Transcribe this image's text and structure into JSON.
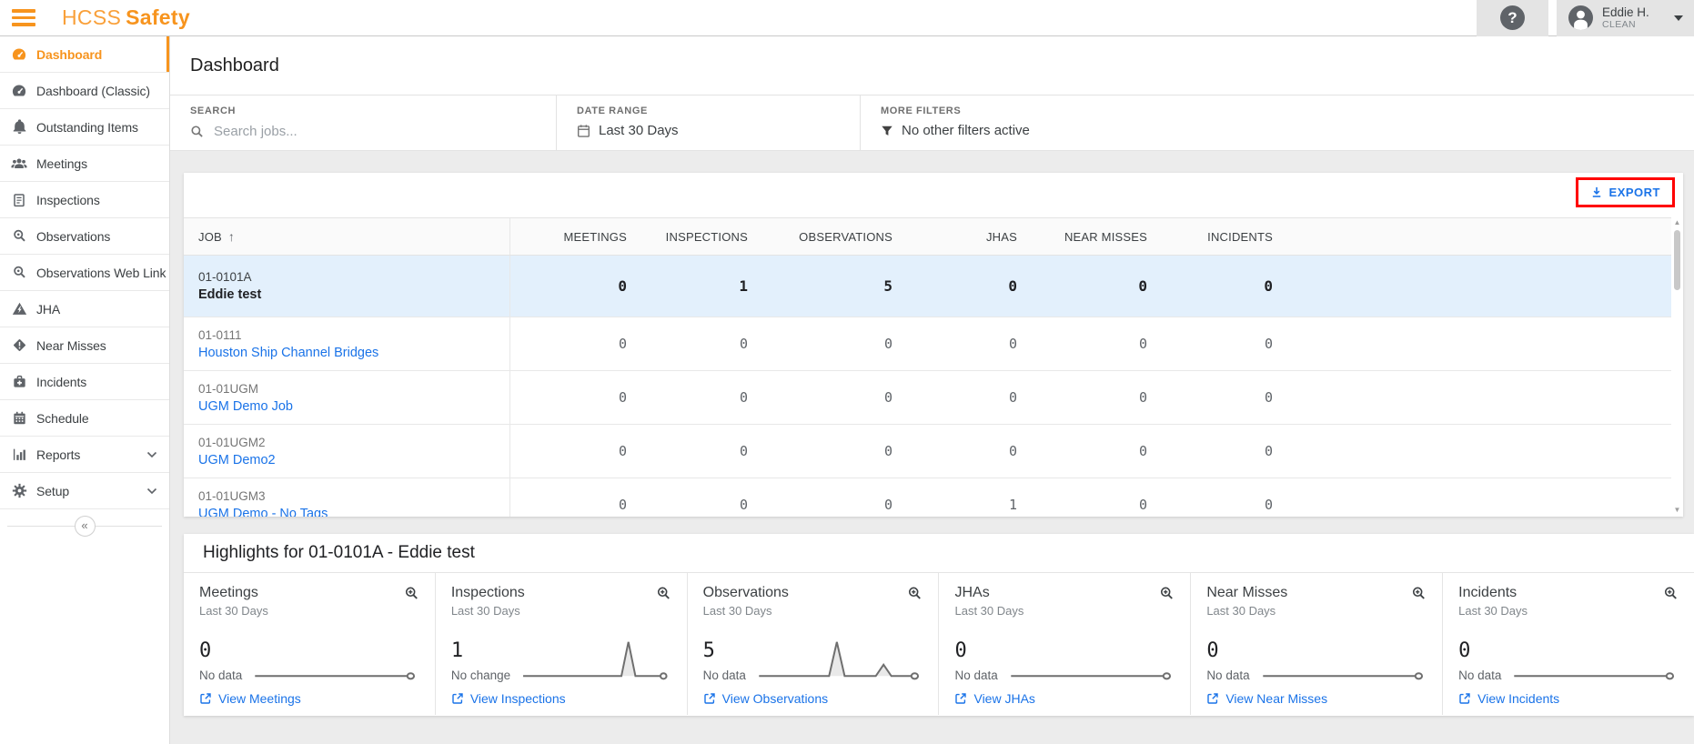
{
  "topbar": {
    "brand_primary": "HCSS",
    "brand_secondary": "Safety",
    "help_glyph": "?",
    "user_name": "Eddie H.",
    "user_company": "CLEAN"
  },
  "sidebar": {
    "items": [
      {
        "label": "Dashboard",
        "icon": "gauge-icon",
        "active": true
      },
      {
        "label": "Dashboard (Classic)",
        "icon": "gauge-icon"
      },
      {
        "label": "Outstanding Items",
        "icon": "bell-icon"
      },
      {
        "label": "Meetings",
        "icon": "people-icon"
      },
      {
        "label": "Inspections",
        "icon": "clipboard-icon"
      },
      {
        "label": "Observations",
        "icon": "magnifier-icon"
      },
      {
        "label": "Observations Web Link",
        "icon": "magnifier-icon"
      },
      {
        "label": "JHA",
        "icon": "warning-triangle-icon"
      },
      {
        "label": "Near Misses",
        "icon": "diamond-alert-icon"
      },
      {
        "label": "Incidents",
        "icon": "medical-bag-icon"
      },
      {
        "label": "Schedule",
        "icon": "calendar-icon"
      },
      {
        "label": "Reports",
        "icon": "bar-chart-icon",
        "expandable": true
      },
      {
        "label": "Setup",
        "icon": "gear-icon",
        "expandable": true
      }
    ],
    "collapse_glyph": "«"
  },
  "page": {
    "title": "Dashboard"
  },
  "filters": {
    "search_label": "SEARCH",
    "search_placeholder": "Search jobs...",
    "date_range_label": "DATE RANGE",
    "date_range_value": "Last 30 Days",
    "more_filters_label": "MORE FILTERS",
    "more_filters_value": "No other filters active"
  },
  "table": {
    "export_label": "EXPORT",
    "sort_indicator": "↑",
    "columns": [
      "JOB",
      "MEETINGS",
      "INSPECTIONS",
      "OBSERVATIONS",
      "JHAS",
      "NEAR MISSES",
      "INCIDENTS"
    ],
    "rows": [
      {
        "code": "01-0101A",
        "name": "Eddie test",
        "selected": true,
        "is_link": false,
        "values": [
          0,
          1,
          5,
          0,
          0,
          0
        ]
      },
      {
        "code": "01-0111",
        "name": "Houston Ship Channel Bridges",
        "selected": false,
        "is_link": true,
        "values": [
          0,
          0,
          0,
          0,
          0,
          0
        ]
      },
      {
        "code": "01-01UGM",
        "name": "UGM Demo Job",
        "selected": false,
        "is_link": true,
        "values": [
          0,
          0,
          0,
          0,
          0,
          0
        ]
      },
      {
        "code": "01-01UGM2",
        "name": "UGM Demo2",
        "selected": false,
        "is_link": true,
        "values": [
          0,
          0,
          0,
          0,
          0,
          0
        ]
      },
      {
        "code": "01-01UGM3",
        "name": "UGM Demo - No Tags",
        "selected": false,
        "is_link": true,
        "values": [
          0,
          0,
          0,
          1,
          0,
          0
        ]
      }
    ]
  },
  "highlights": {
    "title": "Highlights for 01-0101A - Eddie test",
    "cards": [
      {
        "title": "Meetings",
        "subtitle": "Last 30 Days",
        "value": "0",
        "status": "No data",
        "link_label": "View Meetings",
        "spark": [
          0,
          0,
          0,
          0,
          0,
          0,
          0,
          0,
          0,
          0,
          0,
          0,
          0,
          0,
          0,
          0,
          0,
          0,
          0,
          0,
          0
        ]
      },
      {
        "title": "Inspections",
        "subtitle": "Last 30 Days",
        "value": "1",
        "status": "No change",
        "link_label": "View Inspections",
        "spark": [
          0,
          0,
          0,
          0,
          0,
          0,
          0,
          0,
          0,
          0,
          0,
          0,
          0,
          0,
          0,
          1,
          0,
          0,
          0,
          0,
          0
        ]
      },
      {
        "title": "Observations",
        "subtitle": "Last 30 Days",
        "value": "5",
        "status": "No data",
        "link_label": "View Observations",
        "spark": [
          0,
          0,
          0,
          0,
          0,
          0,
          0,
          0,
          0,
          0,
          3,
          0,
          0,
          0,
          0,
          0,
          1,
          0,
          0,
          0,
          0
        ]
      },
      {
        "title": "JHAs",
        "subtitle": "Last 30 Days",
        "value": "0",
        "status": "No data",
        "link_label": "View JHAs",
        "spark": [
          0,
          0,
          0,
          0,
          0,
          0,
          0,
          0,
          0,
          0,
          0,
          0,
          0,
          0,
          0,
          0,
          0,
          0,
          0,
          0,
          0
        ]
      },
      {
        "title": "Near Misses",
        "subtitle": "Last 30 Days",
        "value": "0",
        "status": "No data",
        "link_label": "View Near Misses",
        "spark": [
          0,
          0,
          0,
          0,
          0,
          0,
          0,
          0,
          0,
          0,
          0,
          0,
          0,
          0,
          0,
          0,
          0,
          0,
          0,
          0,
          0
        ]
      },
      {
        "title": "Incidents",
        "subtitle": "Last 30 Days",
        "value": "0",
        "status": "No data",
        "link_label": "View Incidents",
        "spark": [
          0,
          0,
          0,
          0,
          0,
          0,
          0,
          0,
          0,
          0,
          0,
          0,
          0,
          0,
          0,
          0,
          0,
          0,
          0,
          0,
          0
        ]
      }
    ]
  },
  "scrollbar": {
    "up_glyph": "▲",
    "down_glyph": "▼"
  },
  "colors": {
    "accent_orange": "#F7941E",
    "link_blue": "#1A73E8",
    "selected_row_bg": "#E3F0FC",
    "annotation_red": "#FF0000",
    "topbar_box_gray": "#E4E4E4"
  }
}
